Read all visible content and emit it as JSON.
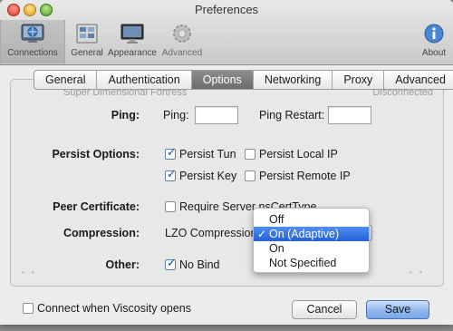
{
  "window": {
    "title": "Preferences"
  },
  "toolbar": {
    "items": [
      {
        "label": "Connections",
        "icon": "connections-icon",
        "active": true
      },
      {
        "label": "General",
        "icon": "general-icon"
      },
      {
        "label": "Appearance",
        "icon": "appearance-icon"
      },
      {
        "label": "Advanced",
        "icon": "advanced-gear-icon"
      }
    ],
    "about_label": "About"
  },
  "tabs": [
    {
      "label": "General"
    },
    {
      "label": "Authentication"
    },
    {
      "label": "Options",
      "selected": true
    },
    {
      "label": "Networking"
    },
    {
      "label": "Proxy"
    },
    {
      "label": "Advanced"
    }
  ],
  "background_row": {
    "name": "Super Dimensional Fortress",
    "status": "Disconnected"
  },
  "options": {
    "ping": {
      "label": "Ping:",
      "ping_field_label": "Ping:",
      "ping_value": "",
      "restart_label": "Ping Restart:",
      "restart_value": ""
    },
    "persist": {
      "label": "Persist Options:",
      "persist_tun": {
        "label": "Persist Tun",
        "checked": true
      },
      "persist_local_ip": {
        "label": "Persist Local IP",
        "checked": false
      },
      "persist_key": {
        "label": "Persist Key",
        "checked": true
      },
      "persist_remote_ip": {
        "label": "Persist Remote IP",
        "checked": false
      }
    },
    "peer_certificate": {
      "label": "Peer Certificate:",
      "require_ns_cert": {
        "label": "Require Server nsCertType",
        "checked": false
      }
    },
    "compression": {
      "label": "Compression:",
      "selected": "LZO Compression",
      "menu_options": [
        "Off",
        "On (Adaptive)",
        "On",
        "Not Specified"
      ],
      "highlighted": "On (Adaptive)"
    },
    "other": {
      "label": "Other:",
      "no_bind": {
        "label": "No Bind",
        "checked": true
      }
    }
  },
  "footer": {
    "connect_on_open": {
      "label": "Connect when Viscosity opens",
      "checked": false
    },
    "cancel_label": "Cancel",
    "save_label": "Save"
  },
  "colors": {
    "accent": "#2460d8",
    "checkmark": "#1d4fa0"
  }
}
